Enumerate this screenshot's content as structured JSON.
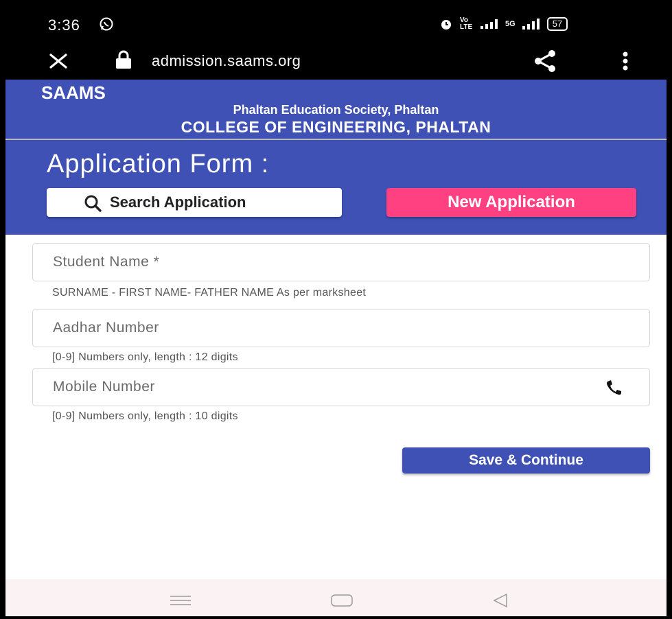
{
  "status_bar": {
    "time": "3:36",
    "network_label": "Vo LTE",
    "signal_5g": "5G",
    "battery": "57"
  },
  "browser": {
    "url": "admission.saams.org"
  },
  "header": {
    "brand": "SAAMS",
    "society": "Phaltan Education Society, Phaltan",
    "college": "COLLEGE OF ENGINEERING, PHALTAN"
  },
  "hero": {
    "title": "Application Form :",
    "search_button": "Search Application",
    "new_button": "New Application"
  },
  "form": {
    "student_name": {
      "placeholder": "Student Name *",
      "hint": "SURNAME - FIRST NAME- FATHER NAME As per marksheet"
    },
    "aadhar": {
      "placeholder": "Aadhar Number",
      "hint": "[0-9] Numbers only, length : 12 digits"
    },
    "mobile": {
      "placeholder": "Mobile Number",
      "hint": "[0-9] Numbers only, length : 10 digits"
    },
    "save_button": "Save & Continue"
  },
  "colors": {
    "primary": "#3f51b5",
    "accent": "#ff4081"
  }
}
